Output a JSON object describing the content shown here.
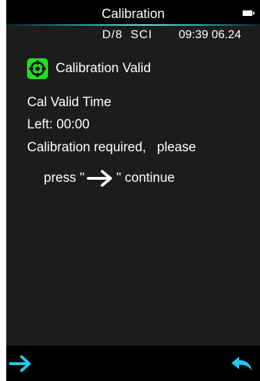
{
  "header": {
    "title": "Calibration",
    "battery_icon": "battery-icon"
  },
  "status": {
    "mode": "D/8  SCI",
    "datetime": "09:39 06.24"
  },
  "calibration": {
    "valid_icon": "calibration-target-icon",
    "valid_label": "Calibration Valid",
    "valid_time_label": "Cal Valid Time",
    "left_text": "Left: 00:00",
    "required_text": "Calibration required,   please",
    "press_prefix": "press \"",
    "press_suffix": "\" continue",
    "press_arrow_icon": "arrow-right-icon"
  },
  "footer": {
    "next_icon": "arrow-right-icon",
    "back_icon": "return-icon"
  },
  "colors": {
    "accent": "#22ccee",
    "valid_green": "#22dd22",
    "background": "#1c1c1c",
    "bar": "#000000"
  }
}
